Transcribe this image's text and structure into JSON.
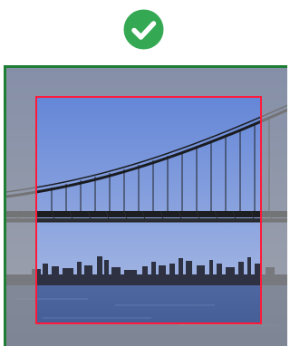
{
  "status": {
    "icon": "check-circle-icon",
    "color": "#34a853"
  },
  "image_crop": {
    "frame_border_color": "#1e7e34",
    "crop_border_color": "#ff1a3a",
    "dim_overlay_color": "rgba(150,150,150,0.72)",
    "sky_top_color": "#5b7fd6",
    "sky_bottom_color": "#b5c4e6",
    "water_color": "#3f5890"
  }
}
